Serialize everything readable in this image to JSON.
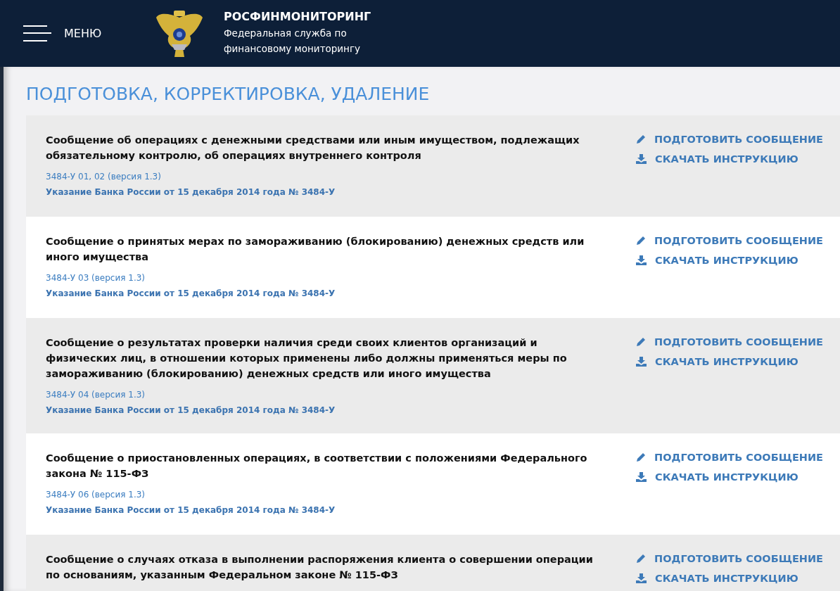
{
  "header": {
    "menu_label": "МЕНЮ",
    "org_name": "РОСФИНМОНИТОРИНГ",
    "org_subtitle_lines": [
      "Федеральная служба по",
      "финансовому мониторингу"
    ]
  },
  "page_title": "ПОДГОТОВКА, КОРРЕКТИРОВКА, УДАЛЕНИЕ",
  "messages": [
    {
      "title": "Сообщение об операциях с денежными средствами или иным имуществом, подлежащих обязательному контролю, об операциях внутреннего контроля",
      "code": "3484-У 01, 02 (версия 1.3)",
      "regulation": "Указание Банка России от 15 декабря 2014 года № 3484-У",
      "actions": [
        "ПОДГОТОВИТЬ СООБЩЕНИЕ",
        "СКАЧАТЬ ИНСТРУКЦИЮ"
      ]
    },
    {
      "title": "Сообщение о принятых мерах по замораживанию (блокированию) денежных средств или иного имущества",
      "code": "3484-У 03 (версия 1.3)",
      "regulation": "Указание Банка России от 15 декабря 2014 года № 3484-У",
      "actions": [
        "ПОДГОТОВИТЬ СООБЩЕНИЕ",
        "СКАЧАТЬ ИНСТРУКЦИЮ"
      ]
    },
    {
      "title": "Сообщение о результатах проверки наличия среди своих клиентов организаций и физических лиц, в отношении которых применены либо должны применяться меры по замораживанию (блокированию) денежных средств или иного имущества",
      "code": "3484-У 04 (версия 1.3)",
      "regulation": "Указание Банка России от 15 декабря 2014 года № 3484-У",
      "actions": [
        "ПОДГОТОВИТЬ СООБЩЕНИЕ",
        "СКАЧАТЬ ИНСТРУКЦИЮ"
      ]
    },
    {
      "title": "Сообщение о приостановленных операциях, в соответствии с положениями Федерального закона № 115-ФЗ",
      "code": "3484-У 06 (версия 1.3)",
      "regulation": "Указание Банка России от 15 декабря 2014 года № 3484-У",
      "actions": [
        "ПОДГОТОВИТЬ СООБЩЕНИЕ",
        "СКАЧАТЬ ИНСТРУКЦИЮ"
      ]
    },
    {
      "title": "Сообщение о случаях отказа в выполнении распоряжения клиента о совершении операции по основаниям, указанным Федеральном законе № 115-ФЗ",
      "actions": [
        "ПОДГОТОВИТЬ СООБЩЕНИЕ",
        "СКАЧАТЬ ИНСТРУКЦИЮ"
      ]
    }
  ]
}
